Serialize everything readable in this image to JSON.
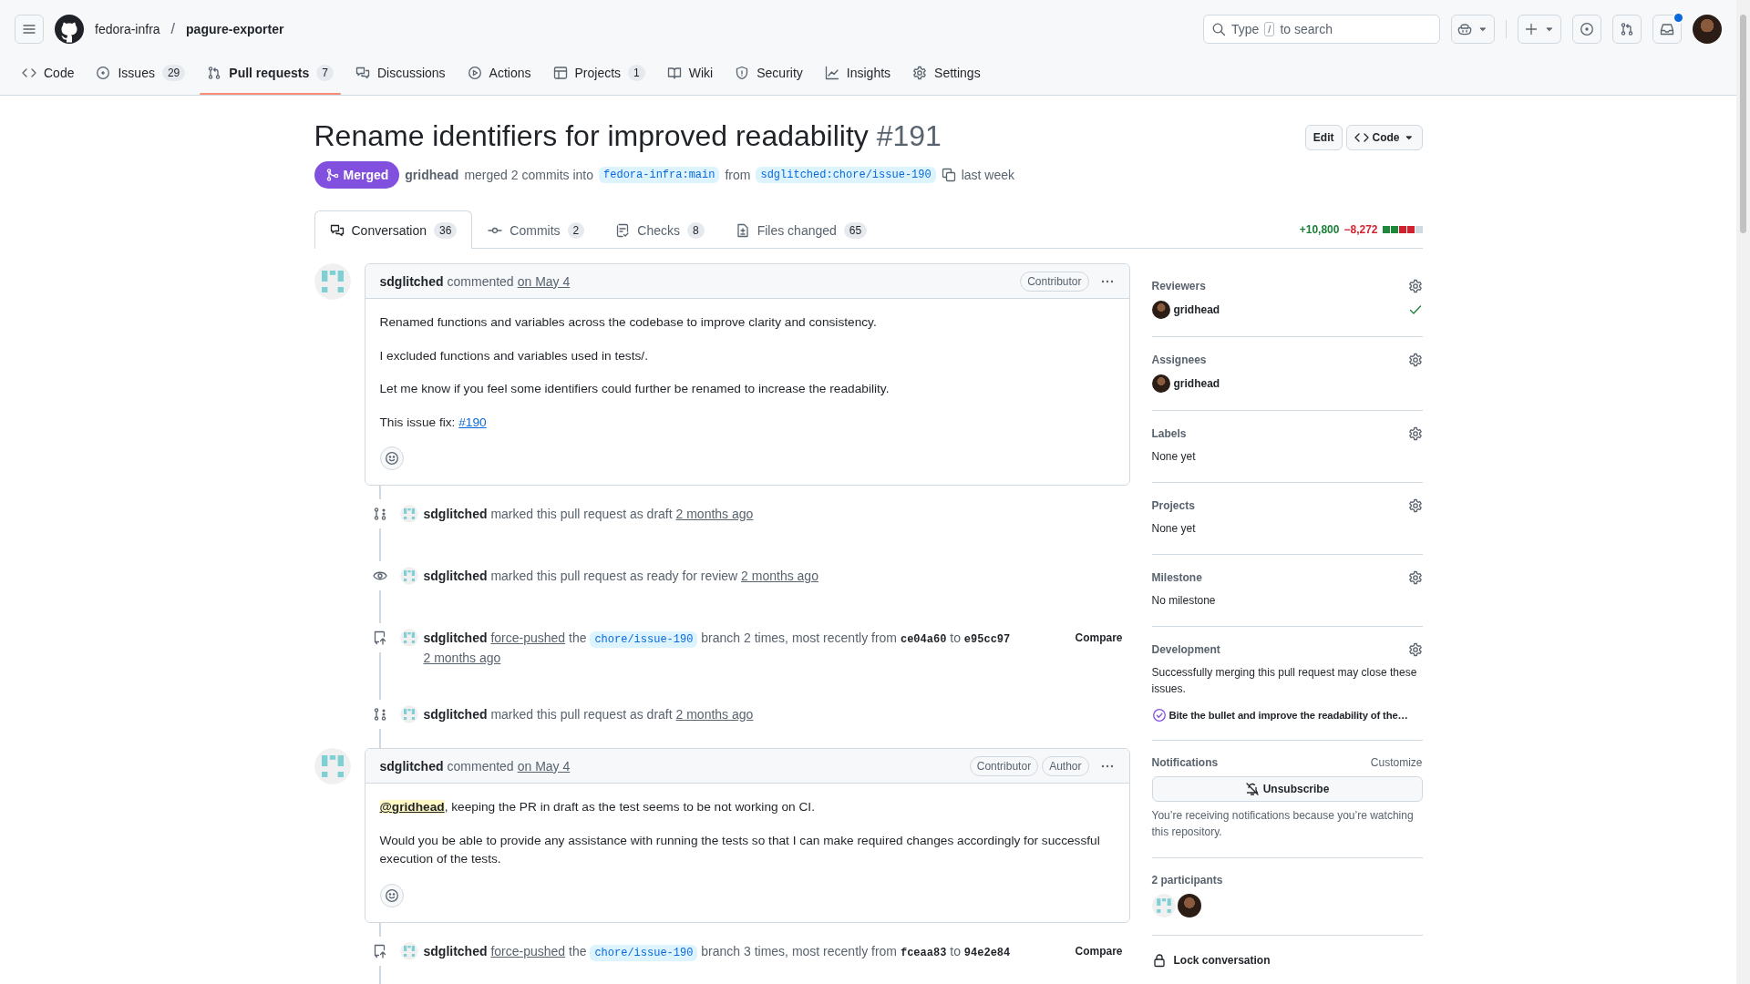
{
  "header": {
    "owner": "fedora-infra",
    "separator": "/",
    "repo": "pagure-exporter",
    "search": {
      "before": "Type",
      "key": "/",
      "after": "to search"
    },
    "inbox_unread": true
  },
  "repo_tabs": [
    {
      "label": "Code",
      "selected": false
    },
    {
      "label": "Issues",
      "count": "29",
      "selected": false
    },
    {
      "label": "Pull requests",
      "count": "7",
      "selected": true
    },
    {
      "label": "Discussions",
      "selected": false
    },
    {
      "label": "Actions",
      "selected": false
    },
    {
      "label": "Projects",
      "count": "1",
      "selected": false
    },
    {
      "label": "Wiki",
      "selected": false
    },
    {
      "label": "Security",
      "selected": false
    },
    {
      "label": "Insights",
      "selected": false
    },
    {
      "label": "Settings",
      "selected": false
    }
  ],
  "pull_request": {
    "title": "Rename identifiers for improved readability",
    "number": "#191",
    "kind": "merged",
    "state_label": "Merged",
    "author": "gridhead",
    "summary": "merged 2 commits into",
    "base": "fedora-infra:main",
    "from": "from",
    "head": "sdglitched:chore/issue-190",
    "time": "last week",
    "buttons": [
      "Edit",
      "Code"
    ]
  },
  "pr_tabs": [
    {
      "label": "Conversation",
      "count": "36",
      "selected": true
    },
    {
      "label": "Commits",
      "count": "2",
      "selected": false
    },
    {
      "label": "Checks",
      "count": "8",
      "selected": false
    },
    {
      "label": "Files changed",
      "count": "65",
      "selected": false
    }
  ],
  "diffstat": {
    "added": "+10,800",
    "deleted": "−8,272",
    "blocks": [
      {
        "color": "#1f883d"
      },
      {
        "color": "#1f883d"
      },
      {
        "color": "#cf222e"
      },
      {
        "color": "#cf222e"
      },
      {
        "color": "#d1d9e0"
      }
    ]
  },
  "timeline": [
    {
      "kind": "comment",
      "author": "sdglitched",
      "verb": "commented",
      "time": "on May 4",
      "badges": [
        "Contributor"
      ],
      "paragraphs": [
        [
          {
            "kind": "text",
            "text": "Renamed functions and variables across the codebase to improve clarity and consistency."
          }
        ],
        [
          {
            "kind": "text",
            "text": "I excluded functions and variables used in tests/."
          }
        ],
        [
          {
            "kind": "text",
            "text": "Let me know if you feel some identifiers could further be renamed to increase the readability."
          }
        ],
        [
          {
            "kind": "text",
            "text": "This issue fix: "
          },
          {
            "kind": "link",
            "text": "#190"
          }
        ]
      ]
    },
    {
      "kind": "draft",
      "actor": "sdglitched",
      "segments": [
        {
          "kind": "text",
          "text": "marked this pull request as draft"
        },
        {
          "kind": "time",
          "text": "2 months ago"
        }
      ]
    },
    {
      "kind": "ready",
      "actor": "sdglitched",
      "segments": [
        {
          "kind": "text",
          "text": "marked this pull request as ready for review"
        },
        {
          "kind": "time",
          "text": "2 months ago"
        }
      ]
    },
    {
      "kind": "force_push",
      "actor": "sdglitched",
      "action": "Compare",
      "segments": [
        {
          "kind": "link",
          "text": "force-pushed"
        },
        {
          "kind": "text",
          "text": "the"
        },
        {
          "kind": "code",
          "text": "chore/issue-190"
        },
        {
          "kind": "text",
          "text": "branch 2 times, most recently from"
        },
        {
          "kind": "sha",
          "text": "ce04a60"
        },
        {
          "kind": "text",
          "text": "to"
        },
        {
          "kind": "sha",
          "text": "e95cc97"
        },
        {
          "kind": "time",
          "text": "2 months ago"
        }
      ]
    },
    {
      "kind": "draft",
      "actor": "sdglitched",
      "segments": [
        {
          "kind": "text",
          "text": "marked this pull request as draft"
        },
        {
          "kind": "time",
          "text": "2 months ago"
        }
      ]
    },
    {
      "kind": "comment",
      "author": "sdglitched",
      "verb": "commented",
      "time": "on May 4",
      "badges": [
        "Contributor",
        "Author"
      ],
      "paragraphs": [
        [
          {
            "kind": "mention",
            "text": "@gridhead"
          },
          {
            "kind": "text",
            "text": ", keeping the PR in draft as the test seems to be not working on CI."
          }
        ],
        [
          {
            "kind": "text",
            "text": "Would you be able to provide any assistance with running the tests so that I can make required changes accordingly for successful execution of the tests."
          }
        ]
      ]
    },
    {
      "kind": "force_push",
      "actor": "sdglitched",
      "action": "Compare",
      "segments": [
        {
          "kind": "link",
          "text": "force-pushed"
        },
        {
          "kind": "text",
          "text": "the"
        },
        {
          "kind": "code",
          "text": "chore/issue-190"
        },
        {
          "kind": "text",
          "text": "branch 3 times, most recently from"
        },
        {
          "kind": "sha",
          "text": "fceaa83"
        },
        {
          "kind": "text",
          "text": "to"
        },
        {
          "kind": "sha",
          "text": "94e2e84"
        }
      ]
    }
  ],
  "sidebar": [
    {
      "kind": "people",
      "title": "Reviewers",
      "people": [
        {
          "name": "gridhead",
          "approved": true
        }
      ]
    },
    {
      "kind": "people",
      "title": "Assignees",
      "people": [
        {
          "name": "gridhead",
          "approved": false
        }
      ]
    },
    {
      "kind": "text",
      "title": "Labels",
      "value": "None yet"
    },
    {
      "kind": "text",
      "title": "Projects",
      "value": "None yet"
    },
    {
      "kind": "text",
      "title": "Milestone",
      "value": "No milestone"
    },
    {
      "kind": "development",
      "title": "Development",
      "value": "Successfully merging this pull request may close these issues.",
      "issue": "Bite the bullet and improve the readability of the…"
    },
    {
      "kind": "notifications",
      "title": "Notifications",
      "link": "Customize",
      "button": "Unsubscribe",
      "value": "You’re receiving notifications because you’re watching this repository."
    },
    {
      "kind": "participants",
      "title": "2 participants",
      "avatars": [
        {
          "kind": "identicon"
        },
        {
          "kind": "photo"
        }
      ]
    },
    {
      "kind": "lock",
      "title": "Lock conversation"
    }
  ]
}
